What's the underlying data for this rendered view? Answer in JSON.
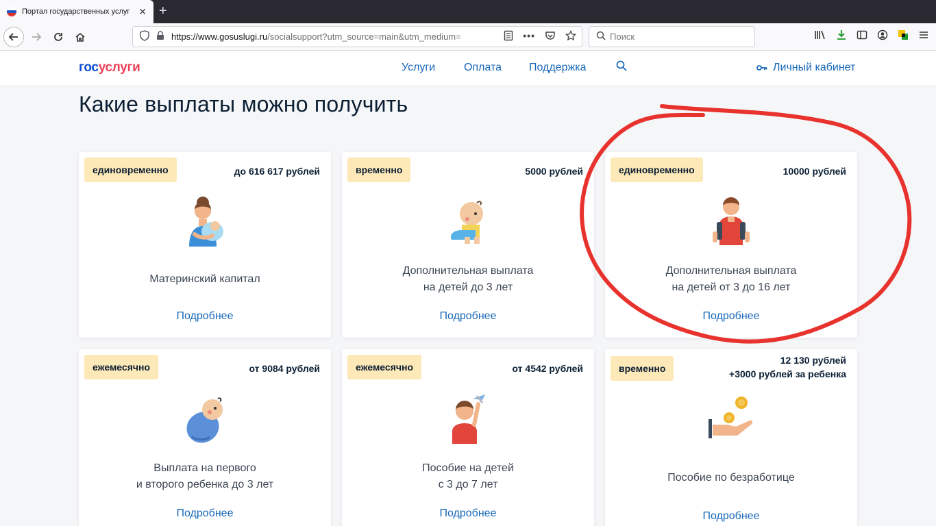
{
  "browser": {
    "tab_title": "Портал государственных услуг",
    "tab_close": "✕",
    "new_tab": "+",
    "url_domain": "https://www.gosuslugi.ru",
    "url_path": "/socialsupport?utm_source=main&utm_medium=",
    "search_placeholder": "Поиск",
    "flag_colors": [
      "#ffffff",
      "#1c57c4",
      "#e0312f"
    ]
  },
  "site": {
    "logo_part1": "гос",
    "logo_part2": "услуги",
    "nav": [
      "Услуги",
      "Оплата",
      "Поддержка"
    ],
    "cabinet": "Личный кабинет",
    "brand_color": "#0d4cd3",
    "accent_color": "#ee3f58",
    "link_color": "#1768b9"
  },
  "page": {
    "title": "Какие выплаты можно получить"
  },
  "cards": [
    {
      "badge": "единовременно",
      "amount": "до 616 617 рублей",
      "title1": "Материнский капитал",
      "title2": "",
      "link": "Подробнее",
      "icon": "mother-with-baby-icon"
    },
    {
      "badge": "временно",
      "amount": "5000 рублей",
      "title1": "Дополнительная выплата",
      "title2": "на детей до 3 лет",
      "link": "Подробнее",
      "icon": "crawling-baby-icon"
    },
    {
      "badge": "единовременно",
      "amount": "10000 рублей",
      "title1": "Дополнительная выплата",
      "title2": "на детей от 3 до 16 лет",
      "link": "Подробнее",
      "icon": "schoolboy-backpack-icon"
    },
    {
      "badge": "ежемесячно",
      "amount": "от 9084 рублей",
      "title1": "Выплата на первого",
      "title2": "и второго ребенка до 3 лет",
      "link": "Подробнее",
      "icon": "swaddled-baby-icon"
    },
    {
      "badge": "ежемесячно",
      "amount": "от 4542 рублей",
      "title1": "Пособие на детей",
      "title2": "с 3 до 7 лет",
      "link": "Подробнее",
      "icon": "child-with-plane-icon"
    },
    {
      "badge": "временно",
      "amount": "12 130 рублей",
      "amount2": "+3000 рублей за ребенка",
      "title1": "Пособие по безработице",
      "title2": "",
      "link": "Подробнее",
      "icon": "hand-with-coins-icon"
    }
  ],
  "annotation_color": "#e8322d"
}
